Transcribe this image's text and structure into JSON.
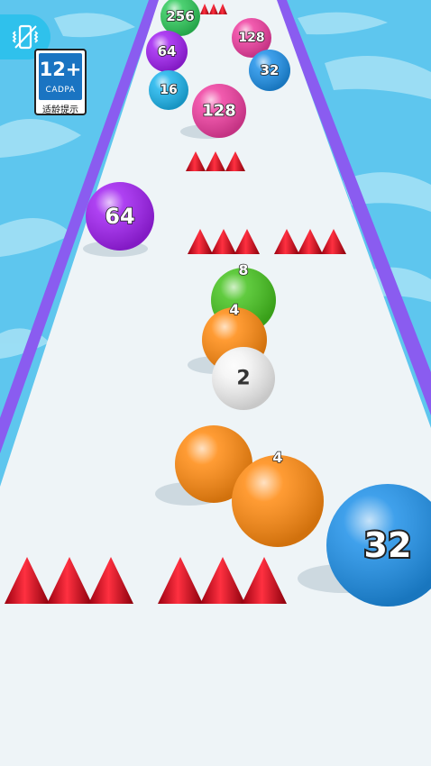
{
  "hud": {
    "exit_icon": "vibration-phone-icon",
    "age_rating": "12+",
    "age_org": "CADPA",
    "age_note": "适龄提示"
  },
  "balls": [
    {
      "label": "256",
      "color": "#2ec95a"
    },
    {
      "label": "64",
      "color": "#a020f0"
    },
    {
      "label": "128",
      "color": "#ef3ea0"
    },
    {
      "label": "32",
      "color": "#1e90e8"
    },
    {
      "label": "16",
      "color": "#1cb4ec"
    },
    {
      "label": "128",
      "color": "#ef3ea0"
    },
    {
      "label": "64",
      "color": "#a020f0"
    },
    {
      "label": "8",
      "color": "#45c21e"
    },
    {
      "label": "4",
      "color": "#ff8a10"
    },
    {
      "label": "2",
      "color": "#f4f4f4"
    },
    {
      "label": "",
      "color": "#ff8a10"
    },
    {
      "label": "4",
      "color": "#ff8a10"
    },
    {
      "label": "32",
      "color": "#1e90e8"
    }
  ],
  "colors": {
    "water": "#5ec6ee",
    "track": "#eef4f7",
    "rail": "#8a5cf0",
    "spike": "#d8101c"
  }
}
